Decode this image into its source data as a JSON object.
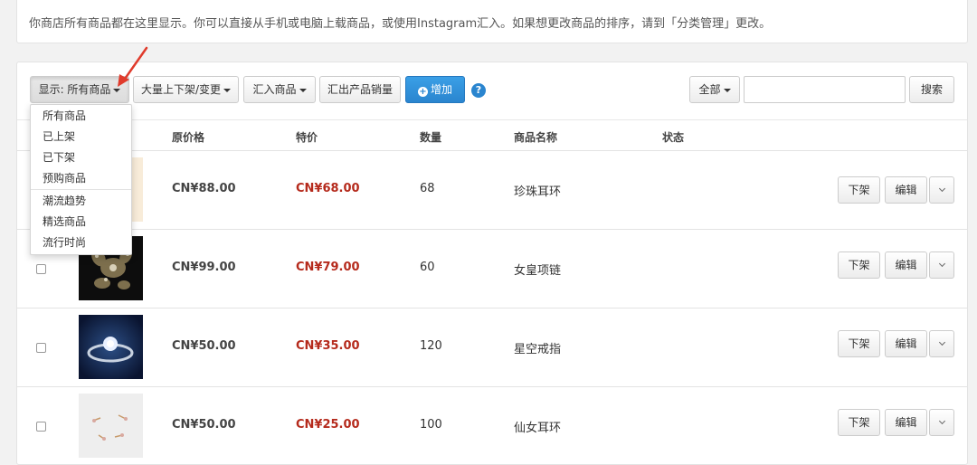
{
  "notice": {
    "text": "你商店所有商品都在这里显示。你可以直接从手机或电脑上载商品，或使用Instagram汇入。如果想更改商品的排序，请到「分类管理」更改。"
  },
  "toolbar": {
    "display_label": "显示: 所有商品",
    "bulk_label": "大量上下架/变更",
    "import_label": "汇入商品",
    "export_label": "汇出产品销量",
    "add_label": "增加",
    "help_glyph": "?",
    "filter_label": "全部",
    "search_placeholder": "",
    "search_button": "搜索"
  },
  "dropdown": {
    "items": [
      "所有商品",
      "已上架",
      "已下架",
      "预购商品",
      "潮流趋势",
      "精选商品",
      "流行时尚"
    ]
  },
  "table": {
    "headers": {
      "original_price": "原价格",
      "special_price": "特价",
      "quantity": "数量",
      "name": "商品名称",
      "status": "状态"
    },
    "rows": [
      {
        "original_price": "CN¥88.00",
        "special_price": "CN¥68.00",
        "quantity": "68",
        "name": "珍珠耳环",
        "action": "下架",
        "edit": "编辑"
      },
      {
        "original_price": "CN¥99.00",
        "special_price": "CN¥79.00",
        "quantity": "60",
        "name": "女皇项链",
        "action": "下架",
        "edit": "编辑"
      },
      {
        "original_price": "CN¥50.00",
        "special_price": "CN¥35.00",
        "quantity": "120",
        "name": "星空戒指",
        "action": "下架",
        "edit": "编辑"
      },
      {
        "original_price": "CN¥50.00",
        "special_price": "CN¥25.00",
        "quantity": "100",
        "name": "仙女耳环",
        "action": "下架",
        "edit": "编辑"
      }
    ]
  },
  "colors": {
    "accent": "#2a85cf",
    "special_price": "#b52a1c",
    "annotation_arrow": "#e03b2c"
  }
}
